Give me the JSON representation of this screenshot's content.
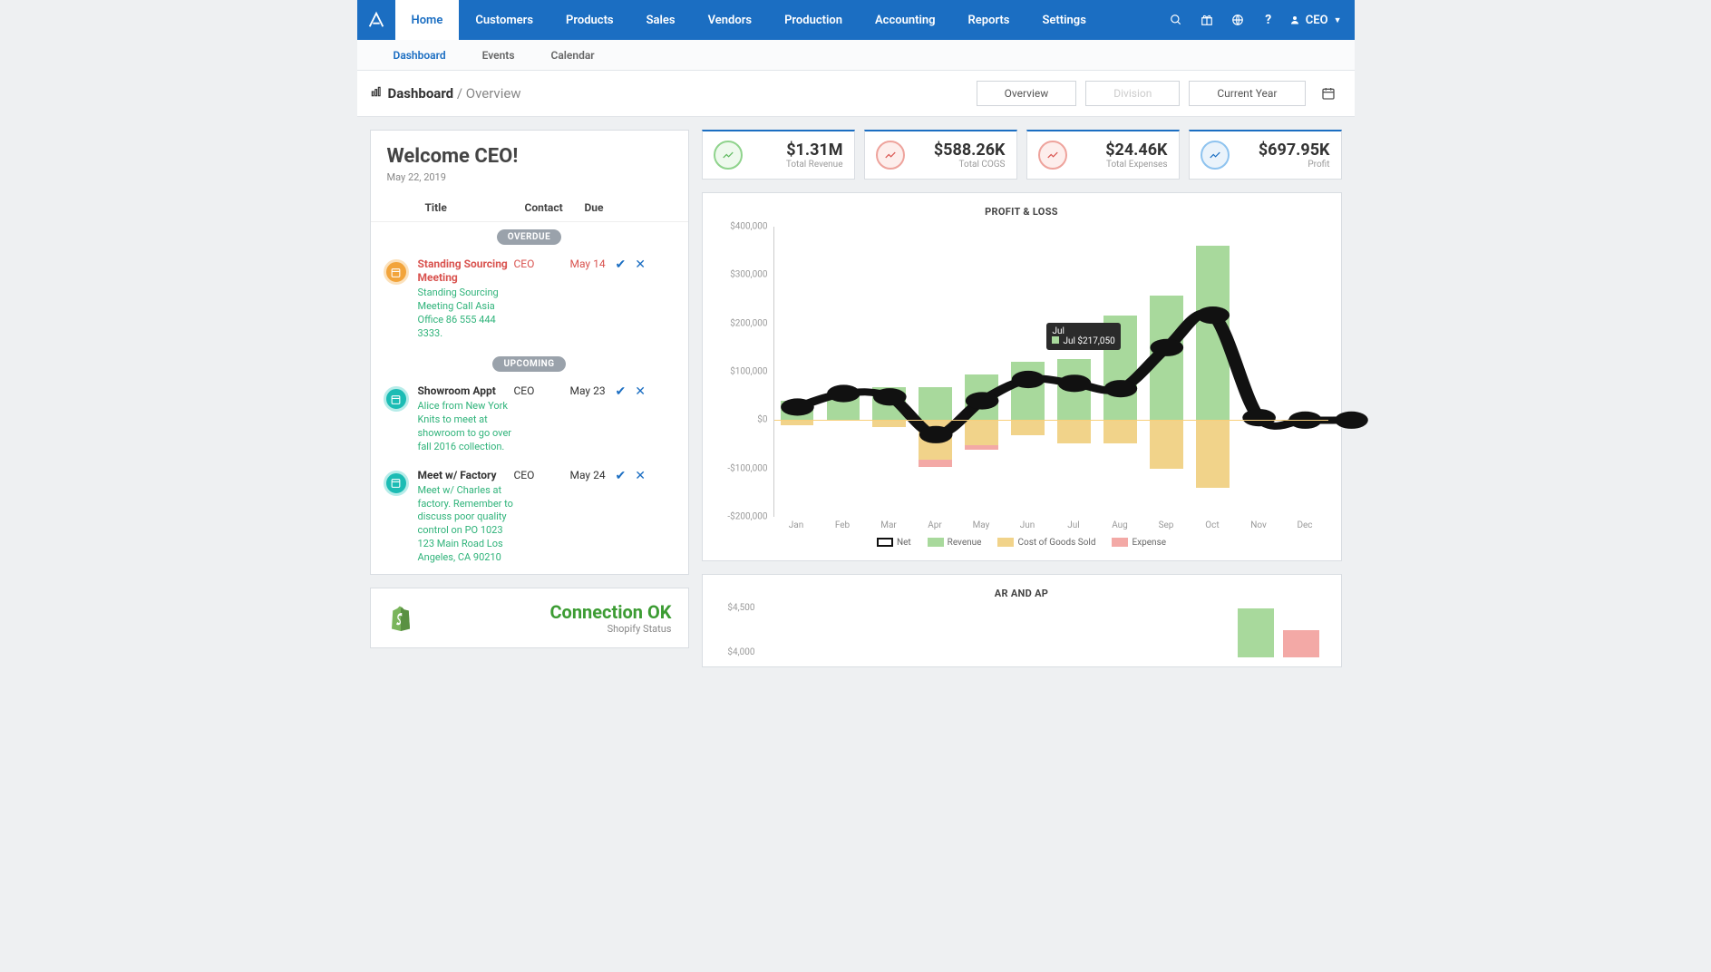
{
  "nav": {
    "items": [
      "Home",
      "Customers",
      "Products",
      "Sales",
      "Vendors",
      "Production",
      "Accounting",
      "Reports",
      "Settings"
    ],
    "active": 0,
    "user_label": "CEO"
  },
  "subnav": {
    "items": [
      "Dashboard",
      "Events",
      "Calendar"
    ],
    "active": 0
  },
  "breadcrumb": {
    "main": "Dashboard",
    "sub": "Overview"
  },
  "selectors": {
    "view": "Overview",
    "division": "Division",
    "period": "Current Year"
  },
  "welcome": {
    "title": "Welcome CEO!",
    "date": "May 22, 2019"
  },
  "schedule": {
    "headers": {
      "title": "Title",
      "contact": "Contact",
      "due": "Due"
    },
    "overdue_label": "OVERDUE",
    "upcoming_label": "UPCOMING",
    "overdue": [
      {
        "title": "Standing Sourcing Meeting",
        "desc": "Standing Sourcing Meeting Call Asia Office 86 555 444 3333.",
        "contact": "CEO",
        "due": "May 14"
      }
    ],
    "upcoming": [
      {
        "title": "Showroom Appt",
        "desc": "Alice from New York Knits to meet at showroom to go over fall 2016 collection.",
        "contact": "CEO",
        "due": "May 23"
      },
      {
        "title": "Meet w/ Factory",
        "desc": "Meet w/ Charles at factory. Remember to discuss poor quality control on PO 1023 123 Main Road Los Angeles, CA 90210",
        "contact": "CEO",
        "due": "May 24"
      }
    ]
  },
  "shopify": {
    "status": "Connection OK",
    "sub": "Shopify Status"
  },
  "kpis": [
    {
      "value": "$1.31M",
      "label": "Total Revenue",
      "color": "green"
    },
    {
      "value": "$588.26K",
      "label": "Total COGS",
      "color": "redish"
    },
    {
      "value": "$24.46K",
      "label": "Total Expenses",
      "color": "red"
    },
    {
      "value": "$697.95K",
      "label": "Profit",
      "color": "blue"
    }
  ],
  "chart_data": [
    {
      "type": "bar",
      "title": "PROFIT & LOSS",
      "categories": [
        "Jan",
        "Feb",
        "Mar",
        "Apr",
        "May",
        "Jun",
        "Jul",
        "Aug",
        "Sep",
        "Oct",
        "Nov",
        "Dec"
      ],
      "ylabel": "",
      "ylim": [
        -200000,
        400000
      ],
      "yticks": [
        "$400,000",
        "$300,000",
        "$200,000",
        "$100,000",
        "$0",
        "-$100,000",
        "-$200,000"
      ],
      "series": [
        {
          "name": "Net",
          "type": "line",
          "values": [
            27000,
            55000,
            48000,
            -30000,
            40000,
            84000,
            76000,
            65000,
            150000,
            217000,
            5000,
            0,
            0
          ]
        },
        {
          "name": "Revenue",
          "type": "bar",
          "values": [
            40000,
            57000,
            68000,
            68000,
            95000,
            120000,
            127000,
            217000,
            258000,
            360000,
            0,
            0,
            0
          ]
        },
        {
          "name": "Cost of Goods Sold",
          "type": "bar",
          "values": [
            -10000,
            0,
            -15000,
            -82000,
            -52000,
            -32000,
            -48000,
            -48000,
            -100000,
            -140000,
            0,
            0,
            0
          ]
        },
        {
          "name": "Expense",
          "type": "bar",
          "values": [
            0,
            0,
            0,
            -15000,
            -10000,
            0,
            0,
            0,
            0,
            0,
            0,
            0,
            0
          ]
        }
      ],
      "tooltip": {
        "month": "Jul",
        "series": "Jul",
        "value": "$217,050"
      },
      "legend": [
        "Net",
        "Revenue",
        "Cost of Goods Sold",
        "Expense"
      ]
    },
    {
      "type": "bar",
      "title": "AR AND AP",
      "yticks": [
        "$4,500",
        "$4,000"
      ],
      "series": [
        {
          "name": "AR",
          "values": [
            4600
          ]
        },
        {
          "name": "AP",
          "values": [
            4200
          ]
        }
      ]
    }
  ]
}
